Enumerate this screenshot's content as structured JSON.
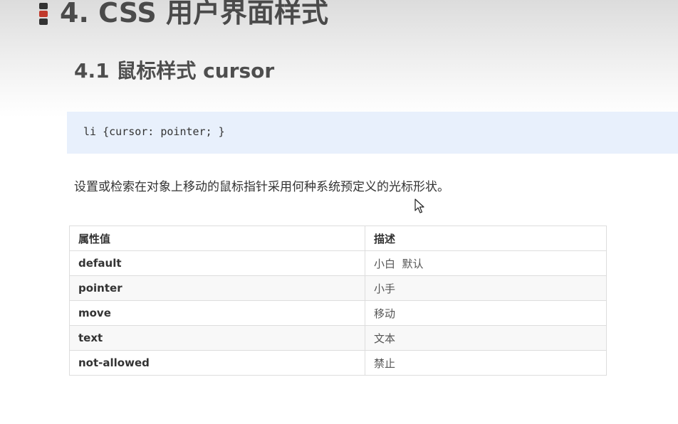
{
  "slide": {
    "main_title": "4. CSS 用户界面样式",
    "section_title": "4.1 鼠标样式 cursor",
    "code": "li {cursor: pointer; }",
    "description": "设置或检索在对象上移动的鼠标指针采用何种系统预定义的光标形状。"
  },
  "colors": {
    "accent_red": "#c0392b",
    "code_background": "#e8f0fc",
    "title_text": "#4a4a4a"
  },
  "table": {
    "headers": [
      "属性值",
      "描述"
    ],
    "rows": [
      {
        "value": "default",
        "desc": "小白  默认"
      },
      {
        "value": "pointer",
        "desc": "小手"
      },
      {
        "value": "move",
        "desc": "移动"
      },
      {
        "value": "text",
        "desc": "文本"
      },
      {
        "value": "not-allowed",
        "desc": "禁止"
      }
    ]
  },
  "icons": {
    "title_marker": "stacked-bars-icon",
    "pointer": "mouse-cursor-icon"
  }
}
